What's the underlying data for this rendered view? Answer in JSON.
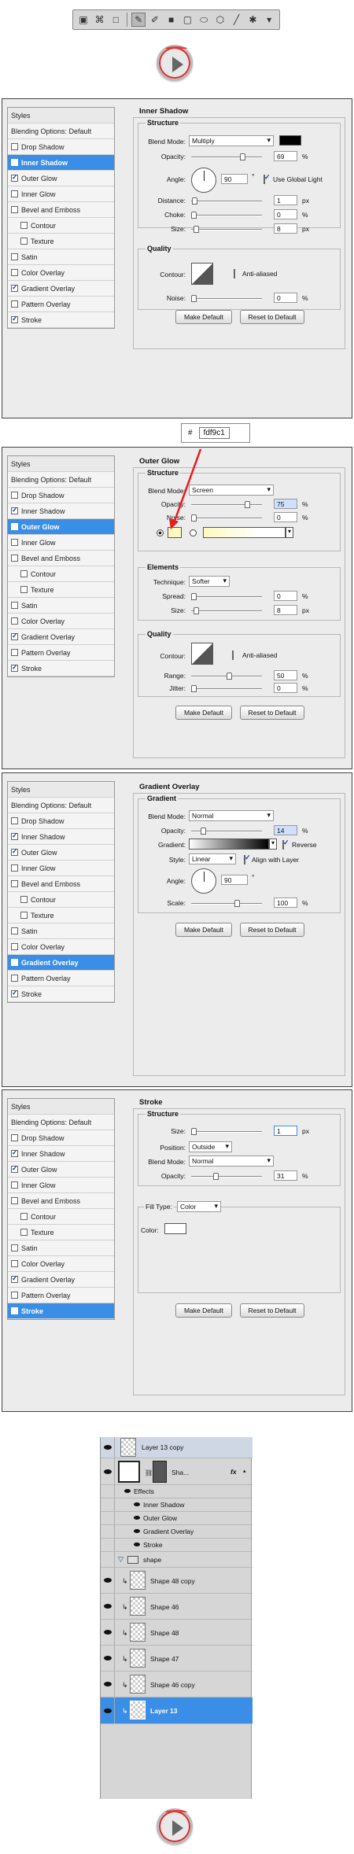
{
  "toolbar": {
    "icons": [
      "rectangle-mode-icon",
      "path-icon",
      "fill-pixels-icon",
      "pen-icon",
      "freeform-pen-icon",
      "rectangle-shape-icon",
      "rounded-rectangle-icon",
      "ellipse-icon",
      "polygon-icon",
      "line-icon",
      "custom-shape-icon",
      "dropdown-arrow-icon"
    ]
  },
  "styles_list": {
    "header": "Styles",
    "blending": "Blending Options: Default",
    "items": [
      "Drop Shadow",
      "Inner Shadow",
      "Outer Glow",
      "Inner Glow",
      "Bevel and Emboss",
      "Contour",
      "Texture",
      "Satin",
      "Color Overlay",
      "Gradient Overlay",
      "Pattern Overlay",
      "Stroke"
    ]
  },
  "common": {
    "make_default": "Make Default",
    "reset_default": "Reset to Default",
    "px": "px",
    "pct": "%",
    "deg": "°"
  },
  "inner_shadow": {
    "title": "Inner Shadow",
    "structure": "Structure",
    "blend_mode_label": "Blend Mode:",
    "blend_mode": "Multiply",
    "color": "#000000",
    "opacity_label": "Opacity:",
    "opacity": "69",
    "angle_label": "Angle:",
    "angle": "90",
    "global_light": "Use Global Light",
    "distance_label": "Distance:",
    "distance": "1",
    "choke_label": "Choke:",
    "choke": "0",
    "size_label": "Size:",
    "size": "8",
    "quality": "Quality",
    "contour_label": "Contour:",
    "anti_aliased": "Anti-aliased",
    "noise_label": "Noise:",
    "noise": "0"
  },
  "hex": {
    "symbol": "#",
    "value": "fdf9c1"
  },
  "outer_glow": {
    "title": "Outer Glow",
    "structure": "Structure",
    "blend_mode_label": "Blend Mode:",
    "blend_mode": "Screen",
    "opacity_label": "Opacity:",
    "opacity": "75",
    "noise_label": "Noise:",
    "noise": "0",
    "color": "#fdf9c1",
    "elements": "Elements",
    "technique_label": "Technique:",
    "technique": "Softer",
    "spread_label": "Spread:",
    "spread": "0",
    "size_label": "Size:",
    "size": "8",
    "quality": "Quality",
    "contour_label": "Contour:",
    "anti_aliased": "Anti-aliased",
    "range_label": "Range:",
    "range": "50",
    "jitter_label": "Jitter:",
    "jitter": "0"
  },
  "gradient_overlay": {
    "title": "Gradient Overlay",
    "section": "Gradient",
    "blend_mode_label": "Blend Mode:",
    "blend_mode": "Normal",
    "opacity_label": "Opacity:",
    "opacity": "14",
    "gradient_label": "Gradient:",
    "reverse": "Reverse",
    "style_label": "Style:",
    "style": "Linear",
    "align": "Align with Layer",
    "angle_label": "Angle:",
    "angle": "90",
    "scale_label": "Scale:",
    "scale": "100"
  },
  "stroke": {
    "title": "Stroke",
    "structure": "Structure",
    "size_label": "Size:",
    "size": "1",
    "position_label": "Position:",
    "position": "Outside",
    "blend_mode_label": "Blend Mode:",
    "blend_mode": "Normal",
    "opacity_label": "Opacity:",
    "opacity": "31",
    "fill_type_label": "Fill Type:",
    "fill_type": "Color",
    "color_label": "Color:",
    "color": "#ffffff"
  },
  "layers": {
    "top": "Layer 13 copy",
    "shape": "Sha...",
    "fx": "fx",
    "effects": "Effects",
    "effect_items": [
      "Inner Shadow",
      "Outer Glow",
      "Gradient Overlay",
      "Stroke"
    ],
    "group": "shape",
    "items": [
      "Shape 48 copy",
      "Shape 46",
      "Shape 48",
      "Shape 47",
      "Shape 46 copy"
    ],
    "selected": "Layer 13"
  }
}
